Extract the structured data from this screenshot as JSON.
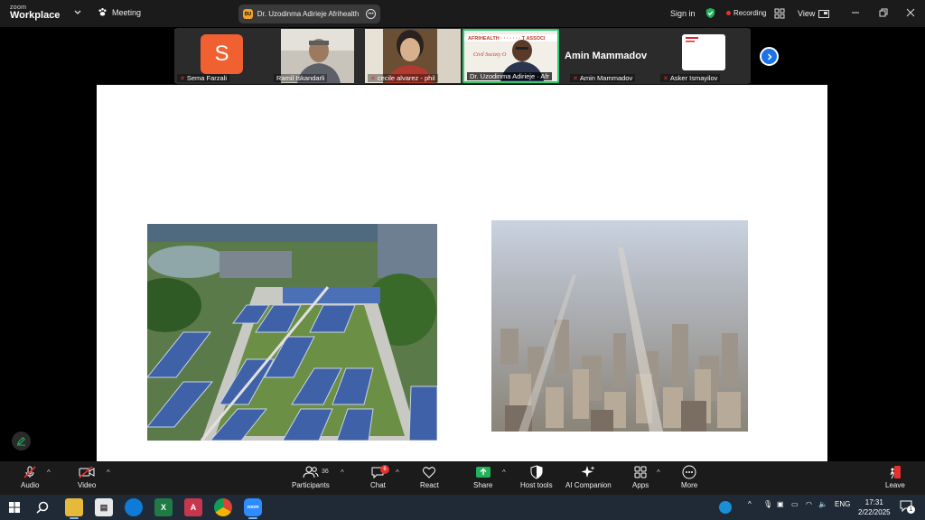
{
  "titlebar": {
    "brand_top": "zoom",
    "brand_bottom": "Workplace",
    "meeting_label": "Meeting",
    "share_badge": "DU",
    "share_text": "Dr. Uzodinma Adirieje  Afrihealth",
    "sign_in": "Sign in",
    "recording": "Recording",
    "view": "View"
  },
  "participants": [
    {
      "name": "Sema Farzali",
      "initial": "S",
      "muted": true
    },
    {
      "name": "Ramil Iskandarli",
      "muted": false
    },
    {
      "name": "cecile alvarez - phil",
      "muted": true
    },
    {
      "name": "Dr. Uzodinma Adirieje · Afr",
      "muted": true,
      "active": true
    },
    {
      "name": "Amin Mammadov",
      "big_name": "Amin Mammadov",
      "muted": true
    },
    {
      "name": "Asker Ismayilov",
      "muted": true
    }
  ],
  "toolbar": {
    "audio": "Audio",
    "video": "Video",
    "participants": "Participants",
    "participants_count": "36",
    "chat": "Chat",
    "chat_badge": "6",
    "react": "React",
    "share": "Share",
    "host_tools": "Host tools",
    "ai_companion": "AI Companion",
    "apps": "Apps",
    "more": "More",
    "leave": "Leave"
  },
  "taskbar": {
    "language": "ENG",
    "time": "17:31",
    "date": "2/22/2025",
    "notifications": "1"
  },
  "colors": {
    "accent_blue": "#1a73e8",
    "share_green": "#21b35b",
    "recording_red": "#e5322e",
    "active_border": "#2ecc71"
  }
}
